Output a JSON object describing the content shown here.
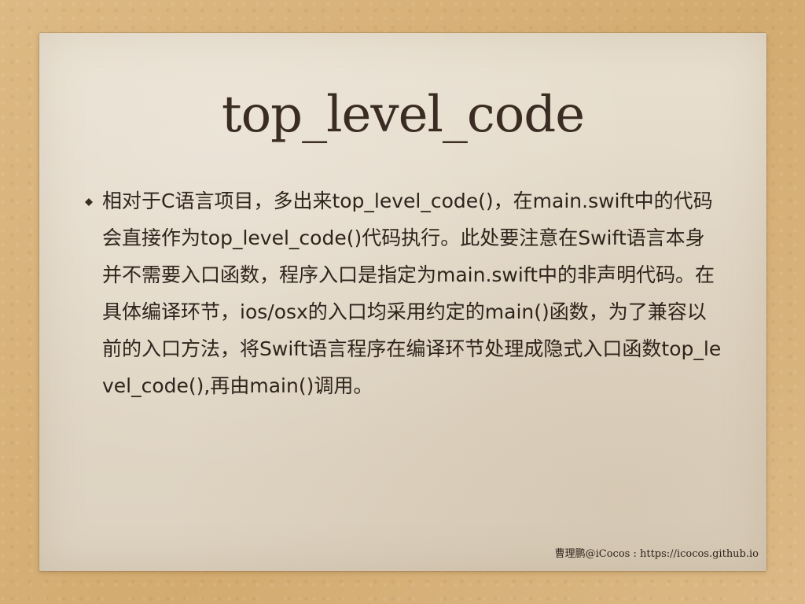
{
  "slide": {
    "title": "top_level_code",
    "bullet_text": "相对于C语言项目，多出来top_level_code()，在main.swift中的代码会直接作为top_level_code()代码执行。此处要注意在Swift语言本身并不需要入口函数，程序入口是指定为main.swift中的非声明代码。在具体编译环节，ios/osx的入口均采用约定的main()函数，为了兼容以前的入口方法，将Swift语言程序在编译环节处理成隐式入口函数top_level_code(),再由main()调用。",
    "footer": "曹理鹏@iCocos : https://icocos.github.io"
  },
  "colors": {
    "background": "#d8b47a",
    "paper": "#e2d8c7",
    "text": "#2f241c"
  },
  "icons": {
    "bullet": "bullet-diamond-icon"
  }
}
